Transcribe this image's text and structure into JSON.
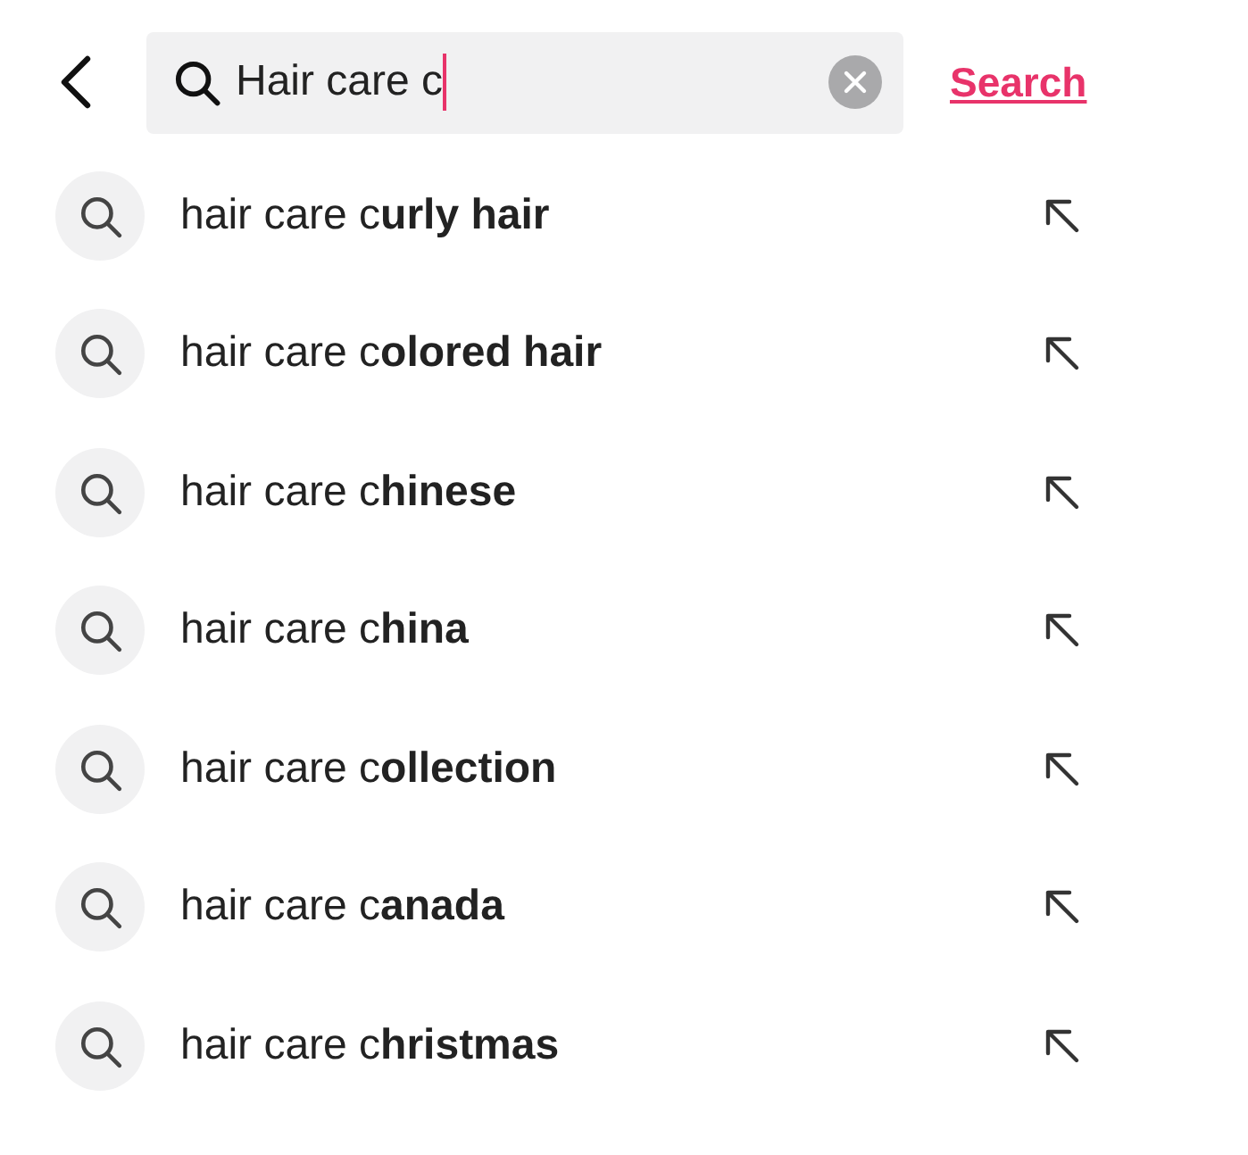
{
  "search": {
    "value": "Hair care c",
    "button": "Search"
  },
  "suggestions": [
    {
      "text": "hair care c**urly hair**"
    },
    {
      "text": "hair care c**olored hair**"
    },
    {
      "text": "hair care c**hinese**"
    },
    {
      "text": "hair care c**hina**"
    },
    {
      "text": "hair care c**ollection**"
    },
    {
      "text": "hair care c**anada**"
    },
    {
      "text": "hair care c**hristmas**"
    }
  ]
}
